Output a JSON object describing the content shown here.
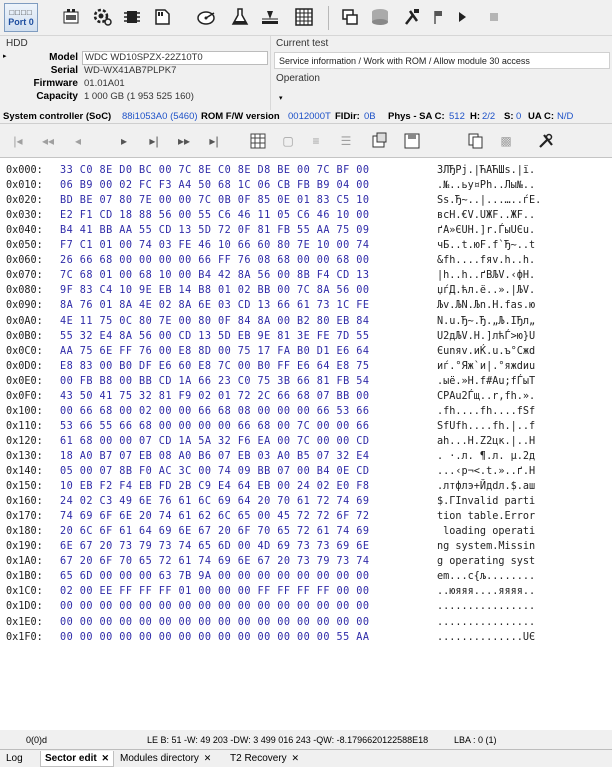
{
  "toolbar": {
    "port_label": "Port 0",
    "port_grid": "□□□□"
  },
  "hdd": {
    "title": "HDD",
    "model_label": "Model",
    "model": "WDC WD10SPZX-22Z10T0",
    "serial_label": "Serial",
    "serial": "WD-WX41AB7PLPK7",
    "firmware_label": "Firmware",
    "firmware": "01.01A01",
    "capacity_label": "Capacity",
    "capacity": "1 000 GB (1 953 525 160)"
  },
  "test": {
    "title": "Current test",
    "current": "Service information / Work with ROM / Allow module 30 access",
    "operation_label": "Operation"
  },
  "status": {
    "controller_label": "System controller (SoC)",
    "controller": "88i1053A0 (5460)",
    "rom_label": "ROM F/W version",
    "rom": "0012000T",
    "fidir_label": "FIDir:",
    "fidir": "0B",
    "phys_label": "Phys - SA C:",
    "phys_c": "512",
    "h_label": "H:",
    "h": "2/2",
    "s_label": "S:",
    "s": "0",
    "uac_label": "UA C:",
    "uac": "N/D"
  },
  "hex_rows": [
    {
      "off": "0x000:",
      "bytes": "33 C0 8E D0 BC 00 7C 8E C0 8E D8 BE 00 7C BF 00",
      "ascii": "3ЛЂРј.|ЋАЋШѕ.|ї."
    },
    {
      "off": "0x010:",
      "bytes": "06 B9 00 02 FC F3 A4 50 68 1C 06 CB FB B9 04 00",
      "ascii": ".№..ьу¤Ph..Лы№.."
    },
    {
      "off": "0x020:",
      "bytes": "BD BE 07 80 7E 00 00 7C 0B 0F 85 0E 01 83 C5 10",
      "ascii": "Ѕѕ.Ђ~..|...…..ѓЕ."
    },
    {
      "off": "0x030:",
      "bytes": "E2 F1 CD 18 88 56 00 55 C6 46 11 05 C6 46 10 00",
      "ascii": "всН.€V.UЖF..ЖF.."
    },
    {
      "off": "0x040:",
      "bytes": "B4 41 BB AA 55 CD 13 5D 72 0F 81 FB 55 AA 75 09",
      "ascii": "ґA»ЄUН.]r.ЃыUЄu."
    },
    {
      "off": "0x050:",
      "bytes": "F7 C1 01 00 74 03 FE 46 10 66 60 80 7E 10 00 74",
      "ascii": "чБ..t.юF.f`Ђ~..t"
    },
    {
      "off": "0x060:",
      "bytes": "26 66 68 00 00 00 00 66 FF 76 08 68 00 00 68 00",
      "ascii": "&fh....fяv.h..h."
    },
    {
      "off": "0x070:",
      "bytes": "7C 68 01 00 68 10 00 B4 42 8A 56 00 8B F4 CD 13",
      "ascii": "|h..h..ґBЉV.‹фН."
    },
    {
      "off": "0x080:",
      "bytes": "9F 83 C4 10 9E EB 14 B8 01 02 BB 00 7C 8A 56 00",
      "ascii": "џѓД.ћл.ё..».|ЉV."
    },
    {
      "off": "0x090:",
      "bytes": "8A 76 01 8A 4E 02 8A 6E 03 CD 13 66 61 73 1C FE",
      "ascii": "Љv.ЉN.Љn.Н.fas.ю"
    },
    {
      "off": "0x0A0:",
      "bytes": "4E 11 75 0C 80 7E 00 80 0F 84 8A 00 B2 80 EB 84",
      "ascii": "N.u.Ђ~.Ђ.„Љ.ІЂл„"
    },
    {
      "off": "0x0B0:",
      "bytes": "55 32 E4 8A 56 00 CD 13 5D EB 9E 81 3E FE 7D 55",
      "ascii": "U2дЉV.Н.]лћЃ>ю}U"
    },
    {
      "off": "0x0C0:",
      "bytes": "AA 75 6E FF 76 00 E8 8D 00 75 17 FA B0 D1 E6 64",
      "ascii": "Єunяv.иЌ.u.ъ°Сжd"
    },
    {
      "off": "0x0D0:",
      "bytes": "E8 83 00 B0 DF E6 60 E8 7C 00 B0 FF E6 64 E8 75",
      "ascii": "иѓ.°Яж`и|.°яжdиu"
    },
    {
      "off": "0x0E0:",
      "bytes": "00 FB B8 00 BB CD 1A 66 23 C0 75 3B 66 81 FB 54",
      "ascii": ".ыё.»Н.f#Аu;fЃыT"
    },
    {
      "off": "0x0F0:",
      "bytes": "43 50 41 75 32 81 F9 02 01 72 2C 66 68 07 BB 00",
      "ascii": "CPAu2Ѓщ..r,fh.»."
    },
    {
      "off": "0x100:",
      "bytes": "00 66 68 00 02 00 00 66 68 08 00 00 00 66 53 66",
      "ascii": ".fh....fh....fSf"
    },
    {
      "off": "0x110:",
      "bytes": "53 66 55 66 68 00 00 00 00 66 68 00 7C 00 00 66",
      "ascii": "SfUfh....fh.|..f"
    },
    {
      "off": "0x120:",
      "bytes": "61 68 00 00 07 CD 1A 5A 32 F6 EA 00 7C 00 00 CD",
      "ascii": "ah...Н.Z2цк.|..Н"
    },
    {
      "off": "0x130:",
      "bytes": "18 A0 B7 07 EB 08 A0 B6 07 EB 03 A0 B5 07 32 E4",
      "ascii": ". ·.л. ¶.л. µ.2д"
    },
    {
      "off": "0x140:",
      "bytes": "05 00 07 8B F0 AC 3C 00 74 09 BB 07 00 B4 0E CD",
      "ascii": "...‹р¬<.t.»..ґ.Н"
    },
    {
      "off": "0x150:",
      "bytes": "10 EB F2 F4 EB FD 2B C9 E4 64 EB 00 24 02 E0 F8",
      "ascii": ".лтфлэ+Йдdл.$.аш"
    },
    {
      "off": "0x160:",
      "bytes": "24 02 C3 49 6E 76 61 6C 69 64 20 70 61 72 74 69",
      "ascii": "$.ГInvalid parti"
    },
    {
      "off": "0x170:",
      "bytes": "74 69 6F 6E 20 74 61 62 6C 65 00 45 72 72 6F 72",
      "ascii": "tion table.Error"
    },
    {
      "off": "0x180:",
      "bytes": "20 6C 6F 61 64 69 6E 67 20 6F 70 65 72 61 74 69",
      "ascii": " loading operati"
    },
    {
      "off": "0x190:",
      "bytes": "6E 67 20 73 79 73 74 65 6D 00 4D 69 73 73 69 6E",
      "ascii": "ng system.Missin"
    },
    {
      "off": "0x1A0:",
      "bytes": "67 20 6F 70 65 72 61 74 69 6E 67 20 73 79 73 74",
      "ascii": "g operating syst"
    },
    {
      "off": "0x1B0:",
      "bytes": "65 6D 00 00 00 63 7B 9A 00 00 00 00 00 00 00 00",
      "ascii": "em...c{љ........"
    },
    {
      "off": "0x1C0:",
      "bytes": "02 00 EE FF FF FF 01 00 00 00 FF FF FF FF 00 00",
      "ascii": "..юяяя....яяяя.."
    },
    {
      "off": "0x1D0:",
      "bytes": "00 00 00 00 00 00 00 00 00 00 00 00 00 00 00 00",
      "ascii": "................"
    },
    {
      "off": "0x1E0:",
      "bytes": "00 00 00 00 00 00 00 00 00 00 00 00 00 00 00 00",
      "ascii": "................"
    },
    {
      "off": "0x1F0:",
      "bytes": "00 00 00 00 00 00 00 00 00 00 00 00 00 00 55 AA",
      "ascii": "..............UЄ"
    }
  ],
  "info": {
    "pos": "0(0)d",
    "values": "LE B: 51 -W: 49 203 -DW: 3 499 016 243 -QW: -8.1796620122588E18",
    "lba": "LBA : 0 (1)"
  },
  "tabs": {
    "log": "Log",
    "sector_edit": "Sector edit",
    "modules": "Modules directory",
    "t2": "T2 Recovery",
    "close": "✕"
  }
}
